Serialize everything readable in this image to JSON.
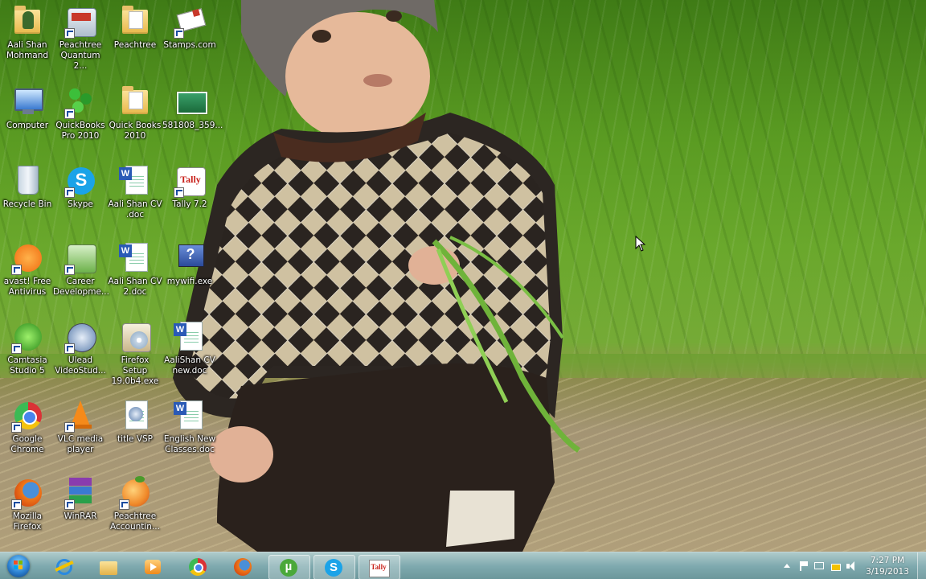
{
  "desktop": {
    "icons": [
      {
        "label": "Aali Shan Mohmand"
      },
      {
        "label": "Peachtree Quantum 2..."
      },
      {
        "label": "Peachtree"
      },
      {
        "label": "Stamps.com"
      },
      {
        "label": "Computer"
      },
      {
        "label": "QuickBooks Pro 2010"
      },
      {
        "label": "Quick Books 2010"
      },
      {
        "label": "581808_359..."
      },
      {
        "label": "Recycle Bin"
      },
      {
        "label": "Skype"
      },
      {
        "label": "Aali Shan CV .doc"
      },
      {
        "label": "Tally 7.2"
      },
      {
        "label": "avast! Free Antivirus"
      },
      {
        "label": "Career Developme..."
      },
      {
        "label": "Aali Shan CV 2.doc"
      },
      {
        "label": "mywifi.exe"
      },
      {
        "label": "Camtasia Studio 5"
      },
      {
        "label": "Ulead VideoStud..."
      },
      {
        "label": "Firefox Setup 19.0b4.exe"
      },
      {
        "label": "AaliShan CV new.doc"
      },
      {
        "label": "Google Chrome"
      },
      {
        "label": "VLC media player"
      },
      {
        "label": "title VSP"
      },
      {
        "label": "English New Classes.doc"
      },
      {
        "label": "Mozilla Firefox"
      },
      {
        "label": "WinRAR"
      },
      {
        "label": "Peachtree Accountin..."
      }
    ]
  },
  "taskbar": {
    "pinned": [
      "internet-explorer",
      "windows-explorer",
      "media-player",
      "google-chrome",
      "mozilla-firefox",
      "utorrent",
      "skype",
      "tally"
    ],
    "clock": {
      "time": "7:27 PM",
      "date": "3/19/2013"
    }
  },
  "colors": {
    "taskbar": "#7fa8ab",
    "grass": "#5a9b22",
    "ground": "#a99868"
  }
}
